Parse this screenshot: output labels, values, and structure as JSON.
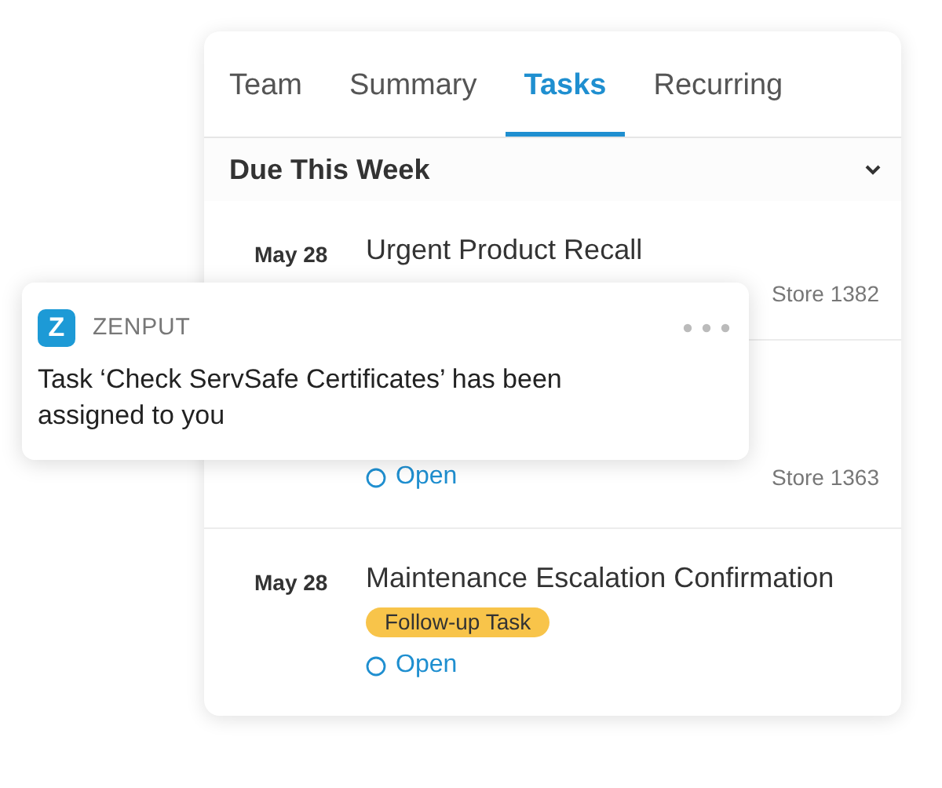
{
  "tabs": [
    {
      "label": "Team",
      "selected": false
    },
    {
      "label": "Summary",
      "selected": false
    },
    {
      "label": "Tasks",
      "selected": true
    },
    {
      "label": "Recurring",
      "selected": false
    }
  ],
  "section": {
    "title": "Due This Week",
    "expanded": true
  },
  "tasks": [
    {
      "date": "May 28",
      "title": "Urgent Product Recall",
      "store": "Store 1382"
    },
    {
      "status": "Open",
      "store": "Store 1363"
    },
    {
      "date": "May 28",
      "title": "Maintenance Escalation Confirmation",
      "badge": "Follow-up Task",
      "status": "Open"
    }
  ],
  "notification": {
    "logo": "Z",
    "app": "ZENPUT",
    "message": "Task ‘Check ServSafe Certificates’ has been assigned to you"
  }
}
